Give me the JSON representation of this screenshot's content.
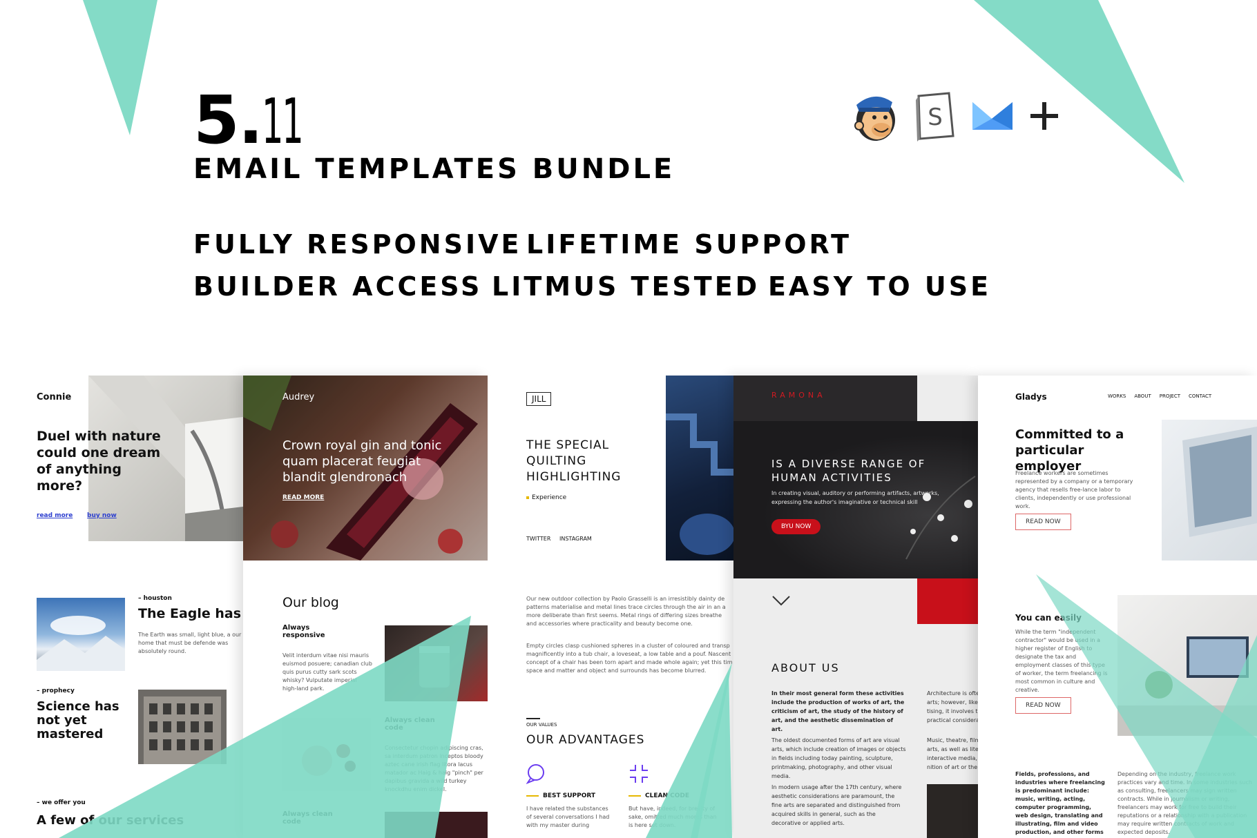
{
  "hero": {
    "version_major": "5.",
    "version_minor": "11",
    "title": "EMAIL TEMPLATES BUNDLE",
    "features": [
      "FULLY RESPONSIVE",
      "LIFETIME SUPPORT",
      "BUILDER ACCESS",
      "LITMUS TESTED",
      "EASY TO USE"
    ],
    "tools": [
      "mailchimp-icon",
      "stampready-icon",
      "campaign-monitor-icon",
      "plus-icon"
    ],
    "tool_letters": {
      "stampready": "S",
      "plus": "+"
    }
  },
  "colors": {
    "accent": "#7dd9c4",
    "red": "#c8101a",
    "dark": "#1c1b1d",
    "link": "#2d3fcf"
  },
  "connie": {
    "brand": "Connie",
    "headline": "Duel with nature could one dream of anything more?",
    "link_read": "read more",
    "link_buy": "buy now",
    "tag_houston": "– houston",
    "eagle_title": "The Eagle has l",
    "eagle_text": "The Earth was small, light blue, a our home that must be defende was absolutely round.",
    "tag_prophecy": "– prophecy",
    "science_title": "Science has not yet mastered",
    "tag_offer": "– we offer you",
    "services_title": "A few of our services"
  },
  "audrey": {
    "brand": "Audrey",
    "headline": "Crown royal gin and tonic quam placerat feugiat blandit glendronach",
    "read_more": "READ MORE",
    "blog_title": "Our blog",
    "item1_title": "Always responsive",
    "item1_text": "Velit interdum vitae nisi mauris euismod posuere; canadian club quis purus cutty sark scots whisky? Vulputate imperial high-land park.",
    "item2_title": "Always clean code",
    "item2_text": "Consectetur chopin adipiscing cras, sa interdum patron inceptos bloody aztec cane irish flag litora lacus matador ac Haig & haig \"pinch\" per dapibus gravida a wild turkey knockdhu enim dickel.",
    "item3_title": "Always clean code"
  },
  "jill": {
    "brand": "JILL",
    "headline": "THE SPECIAL QUILTING HIGHLIGHTING",
    "tag": "Experience",
    "social1": "TWITTER",
    "social2": "INSTAGRAM",
    "para1": "Our new outdoor collection by Paolo Grasselli is an irresistibly dainty de patterns materialise and metal lines trace circles through the air in an a more deliberate than first seems. Metal rings of differing sizes breathe and accessories where practicality and beauty become one.",
    "para2": "Empty circles clasp cushioned spheres in a cluster of coloured and transp magnificently into a tub chair, a loveseat, a low table and a pouf. Nascent concept of a chair has been torn apart and made whole again; yet this tim space and matter and object and surrounds has become blurred.",
    "values_tag": "OUR VALUES",
    "advantages_title": "OUR ADVANTAGES",
    "adv1_title": "BEST SUPPORT",
    "adv1_text": "I have related the substances of several conversations I had with my master during",
    "adv2_title": "CLEAN CODE",
    "adv2_text": "But have, indeed, for brevity of sake, omitted much mores than is here set down."
  },
  "ramona": {
    "brand": "RAMONA",
    "headline": "IS A DIVERSE RANGE OF HUMAN ACTIVITIES",
    "sub": "In creating visual, auditory or performing artifacts, artworks, expressing the author's imaginative or technical skill",
    "cta": "BYU NOW",
    "about_title": "ABOUT US",
    "about_col1_p1": "In their most general form these activities include the production of works of art, the criticism of art, the study of the history of art, and the aesthetic dissemination of art.",
    "about_col1_p2": "The oldest documented forms of art are visual arts, which include creation of images or objects in fields including today painting, sculpture, printmaking, photography, and other visual media.",
    "about_col1_p3": "In modern usage after the 17th century, where aesthetic considerations are paramount, the fine arts are separated and distinguished from acquired skills in general, such as the decorative or applied arts.",
    "about_col2_p1": "Architecture is ofte arts; however, like tising, it involves th practical considera",
    "about_col2_p2": "Music, theatre, film arts, as well as lite interactive media, c nition of art or the"
  },
  "gladys": {
    "brand": "Gladys",
    "nav": [
      "WORKS",
      "ABOUT",
      "PROJECT",
      "CONTACT"
    ],
    "headline": "Committed to a particular employer",
    "text": "Freelance workers are sometimes represented by a company or a temporary agency that resells free-lance labor to clients, independently or use professional work.",
    "cta1": "READ NOW",
    "sub_title": "You can easily",
    "sub_text": "While the term \"independent contractor\" would be used in a higher register of English to designate the tax and employment classes of this type of worker, the term freelancing is most common in culture and creative.",
    "cta2": "READ NOW",
    "col1": "Fields, professions, and industries where freelancing is predominant include: music, writing, acting, computer programming, web design, translating and illustrating, film and video production, and other forms of piece work which some cultural.",
    "col2": "Depending on the industry, freelance work practices vary and time. In some industries such as consulting, freelancers may sign written contracts. While in journalism or writing, freelancers may work for free to build their reputations or a relationship with a publication may require written contracts of work and expected deposits."
  }
}
